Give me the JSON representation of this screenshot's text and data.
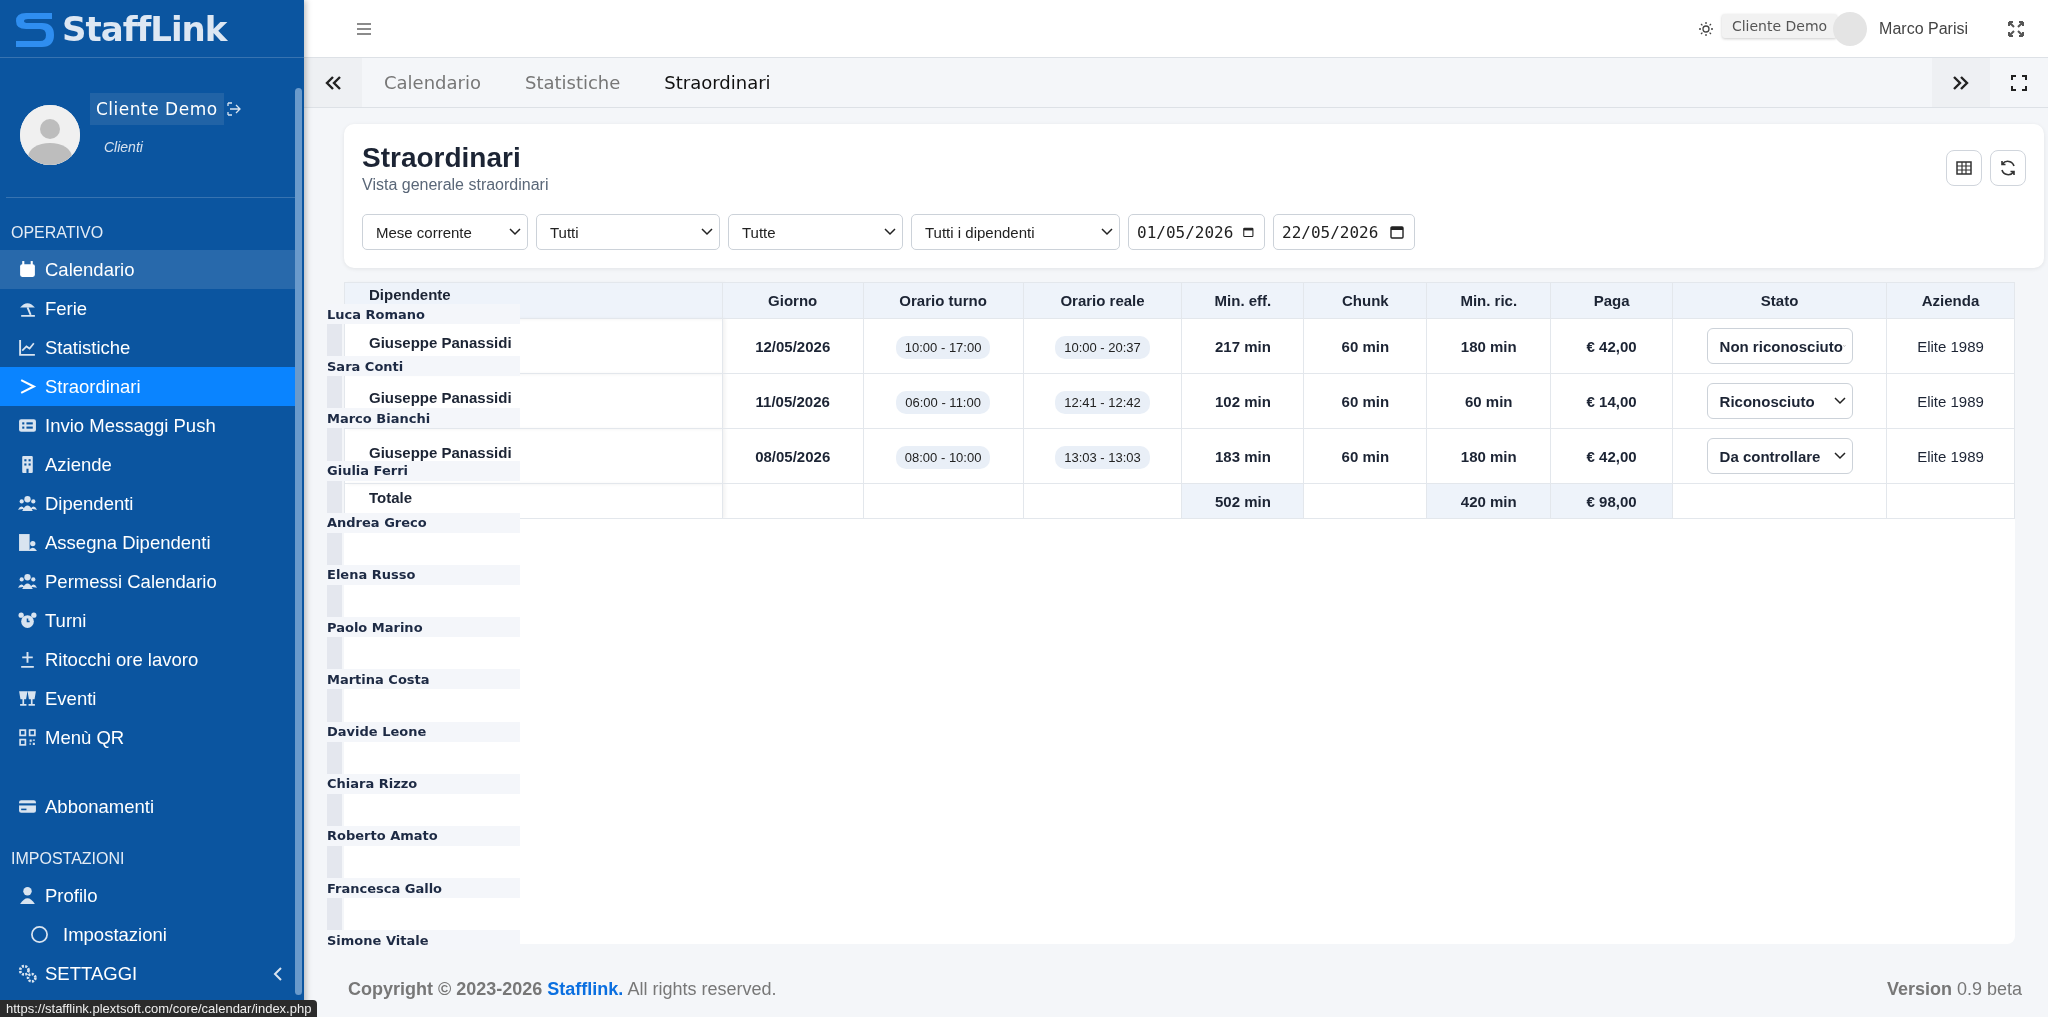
{
  "sidebar": {
    "logo": "StaffLink",
    "user": {
      "name": "Cliente Demo",
      "role": "Clienti"
    },
    "sections": [
      {
        "title": "OPERATIVO",
        "items": [
          {
            "label": "Calendario",
            "selected": false,
            "hovered": true
          },
          {
            "label": "Ferie",
            "selected": false,
            "hovered": false
          },
          {
            "label": "Statistiche",
            "selected": false,
            "hovered": false
          },
          {
            "label": "Straordinari",
            "selected": true,
            "hovered": false
          },
          {
            "label": "Invio Messaggi Push",
            "selected": false,
            "hovered": false
          },
          {
            "label": "Aziende",
            "selected": false,
            "hovered": false
          },
          {
            "label": "Dipendenti",
            "selected": false,
            "hovered": false
          },
          {
            "label": "Assegna Dipendenti",
            "selected": false,
            "hovered": false
          },
          {
            "label": "Permessi Calendario",
            "selected": false,
            "hovered": false
          },
          {
            "label": "Turni",
            "selected": false,
            "hovered": false
          },
          {
            "label": "Ritocchi ore lavoro",
            "selected": false,
            "hovered": false
          },
          {
            "label": "Eventi",
            "selected": false,
            "hovered": false
          },
          {
            "label": "Menù QR",
            "selected": false,
            "hovered": false
          },
          {
            "label": "Abbonamenti",
            "selected": false,
            "hovered": false
          }
        ]
      },
      {
        "title": "IMPOSTAZIONI",
        "items": [
          {
            "label": "Profilo",
            "selected": false,
            "hovered": false,
            "children": [
              {
                "label": "Impostazioni",
                "selected": false,
                "hovered": false
              }
            ]
          },
          {
            "label": "SETTAGGI",
            "selected": false,
            "hovered": false,
            "expanded": false
          }
        ]
      }
    ]
  },
  "topbar": {
    "tooltip": "Cliente Demo",
    "user_name": "Marco Parisi"
  },
  "tabs": [
    {
      "label": "Calendario",
      "selected": false
    },
    {
      "label": "Statistiche",
      "selected": false
    },
    {
      "label": "Straordinari",
      "selected": true
    }
  ],
  "card": {
    "title": "Straordinari",
    "subtitle": "Vista generale straordinari",
    "filters": [
      {
        "kind": "select",
        "value": "Mese corrente"
      },
      {
        "kind": "select",
        "value": "Tutti"
      },
      {
        "kind": "select",
        "value": "Tutte"
      },
      {
        "kind": "select",
        "value": "Tutti i dipendenti"
      },
      {
        "kind": "date",
        "value": "01/05/2026"
      },
      {
        "kind": "date",
        "value": "22/05/2026"
      }
    ]
  },
  "table": {
    "columns": [
      "Dipendente",
      "Giorno",
      "Orario turno",
      "Orario reale",
      "Min. eff.",
      "Chunk",
      "Min. ric.",
      "Paga",
      "Stato",
      "Azienda"
    ],
    "rows": [
      {
        "dipendente": "Giuseppe Panassidi",
        "giorno": "12/05/2026",
        "orario_turno": "10:00 - 17:00",
        "orario_reale": "10:00 - 20:37",
        "min_eff": "217 min",
        "chunk": "60 min",
        "min_ric": "180 min",
        "paga": "€ 42,00",
        "stato": "Non riconosciuto",
        "azienda": "Elite 1989"
      },
      {
        "dipendente": "Giuseppe Panassidi",
        "giorno": "11/05/2026",
        "orario_turno": "06:00 - 11:00",
        "orario_reale": "12:41 - 12:42",
        "min_eff": "102 min",
        "chunk": "60 min",
        "min_ric": "60 min",
        "paga": "€ 14,00",
        "stato": "Riconosciuto",
        "azienda": "Elite 1989"
      },
      {
        "dipendente": "Giuseppe Panassidi",
        "giorno": "08/05/2026",
        "orario_turno": "08:00 - 10:00",
        "orario_reale": "13:03 - 13:03",
        "min_eff": "183 min",
        "chunk": "60 min",
        "min_ric": "180 min",
        "paga": "€ 42,00",
        "stato": "Da controllare",
        "azienda": "Elite 1989"
      }
    ],
    "total": {
      "label": "Totale",
      "min_eff": "502 min",
      "min_ric": "420 min",
      "paga": "€ 98,00"
    }
  },
  "employee_list": [
    "Luca Romano",
    "Sara Conti",
    "Marco Bianchi",
    "Giulia Ferri",
    "Andrea Greco",
    "Elena Russo",
    "Paolo Marino",
    "Martina Costa",
    "Davide Leone",
    "Chiara Rizzo",
    "Roberto Amato",
    "Francesca Gallo",
    "Simone Vitale"
  ],
  "footer": {
    "copyright": "Copyright © 2023-2026",
    "brand": "Stafflink.",
    "rights": "All rights reserved.",
    "version": "**Version** 0.9 beta"
  },
  "status_url": "https://stafflink.plextsoft.com/core/calendar/index.php"
}
